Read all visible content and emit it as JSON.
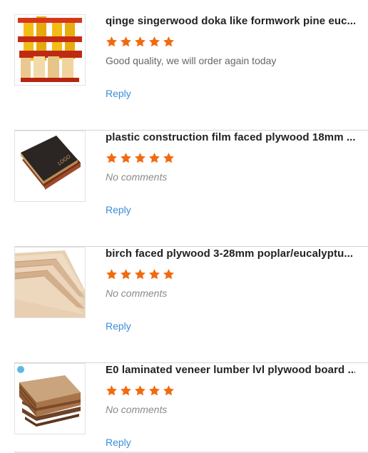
{
  "reviews": [
    {
      "title": "qinge singerwood doka like formwork pine euc...",
      "rating": 5,
      "comment": "Good quality, we will order again today",
      "reply": "Reply",
      "thumbnail_icon": "formwork-beam-image"
    },
    {
      "title": "plastic construction film faced plywood 18mm ...",
      "rating": 5,
      "comment": "No comments",
      "reply": "Reply",
      "thumbnail_icon": "film-faced-plywood-image"
    },
    {
      "title": "birch faced plywood 3-28mm poplar/eucalyptu...",
      "rating": 5,
      "comment": "No comments",
      "reply": "Reply",
      "thumbnail_icon": "birch-plywood-image"
    },
    {
      "title": "E0 laminated veneer lumber lvl plywood board ...",
      "rating": 5,
      "comment": "No comments",
      "reply": "Reply",
      "thumbnail_icon": "lvl-board-image"
    }
  ],
  "colors": {
    "star": "#f26a10",
    "reply_link": "#3b8ed8",
    "divider": "#d6d6d6"
  }
}
